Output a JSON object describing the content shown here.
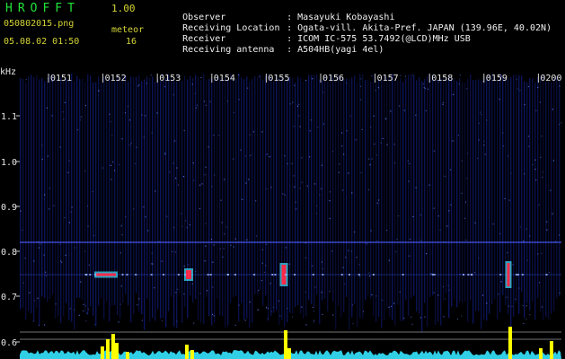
{
  "header": {
    "app_title": "HROFFT",
    "app_version": "1.00",
    "file_name": "050802015.png",
    "date_time": "05.08.02 01:50",
    "meteor_label": "meteor",
    "meteor_count": "16"
  },
  "info": [
    {
      "key": "Observer",
      "value": "Masayuki Kobayashi"
    },
    {
      "key": "Receiving Location",
      "value": "Ogata-vill. Akita-Pref. JAPAN (139.96E, 40.02N)"
    },
    {
      "key": "Receiver",
      "value": "ICOM IC-575 53.7492(@LCD)MHz USB"
    },
    {
      "key": "Receiving antenna",
      "value": "A504HB(yagi 4el)"
    }
  ],
  "axes": {
    "y_unit": "kHz",
    "y_ticks": [
      "1.1",
      "1.0",
      "0.9",
      "0.8",
      "0.7",
      "0.6"
    ],
    "time_ticks": [
      "0151",
      "0152",
      "0153",
      "0154",
      "0155",
      "0156",
      "0157",
      "0158",
      "0159",
      "0200"
    ]
  },
  "colors": {
    "background": "#000000",
    "noise_blue": "#1b2fd0",
    "meteor_core": "#ff2a4a",
    "meteor_edge": "#42e3ff",
    "marker_yellow": "#ffff00",
    "baseline_cyan": "#36e6ff",
    "header_yellow": "#d4d437",
    "header_green": "#22e33a"
  }
}
